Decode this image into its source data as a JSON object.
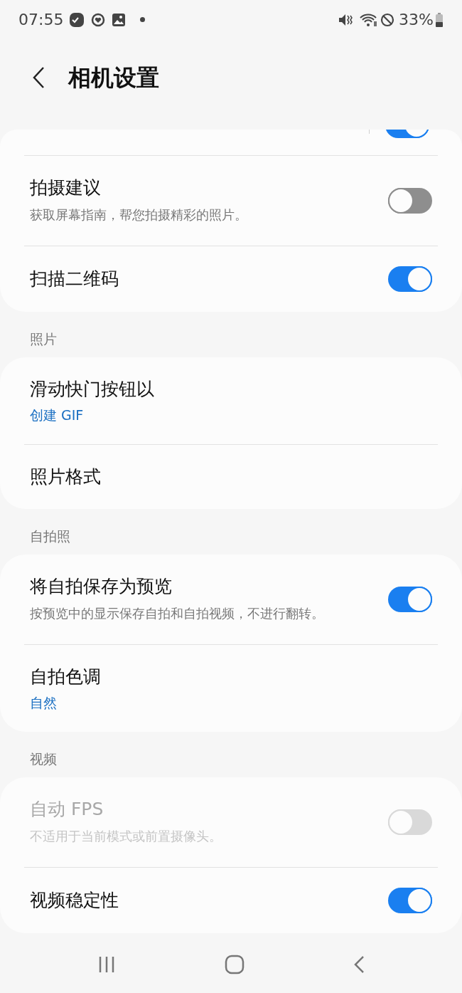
{
  "status_bar": {
    "time": "07:55",
    "battery": "33%"
  },
  "header": {
    "title": "相机设置"
  },
  "sections": [
    {
      "items": [
        {
          "kind": "clipped",
          "on": true,
          "disabled": false
        },
        {
          "kind": "toggle",
          "title": "拍摄建议",
          "subtitle": "获取屏幕指南，帮您拍摄精彩的照片。",
          "on": false,
          "disabled": false
        },
        {
          "kind": "toggle",
          "title": "扫描二维码",
          "on": true,
          "disabled": false
        }
      ]
    },
    {
      "header": "照片",
      "items": [
        {
          "kind": "value",
          "title": "滑动快门按钮以",
          "value": "创建 GIF",
          "disabled": false
        },
        {
          "kind": "value",
          "title": "照片格式",
          "disabled": false
        }
      ]
    },
    {
      "header": "自拍照",
      "items": [
        {
          "kind": "toggle",
          "title": "将自拍保存为预览",
          "subtitle": "按预览中的显示保存自拍和自拍视频，不进行翻转。",
          "on": true,
          "disabled": false
        },
        {
          "kind": "value",
          "title": "自拍色调",
          "value": "自然",
          "disabled": false
        }
      ]
    },
    {
      "header": "视频",
      "items": [
        {
          "kind": "toggle",
          "title": "自动 FPS",
          "subtitle": "不适用于当前模式或前置摄像头。",
          "on": false,
          "disabled": true
        },
        {
          "kind": "toggle",
          "title": "视频稳定性",
          "on": true,
          "disabled": false
        }
      ]
    }
  ]
}
